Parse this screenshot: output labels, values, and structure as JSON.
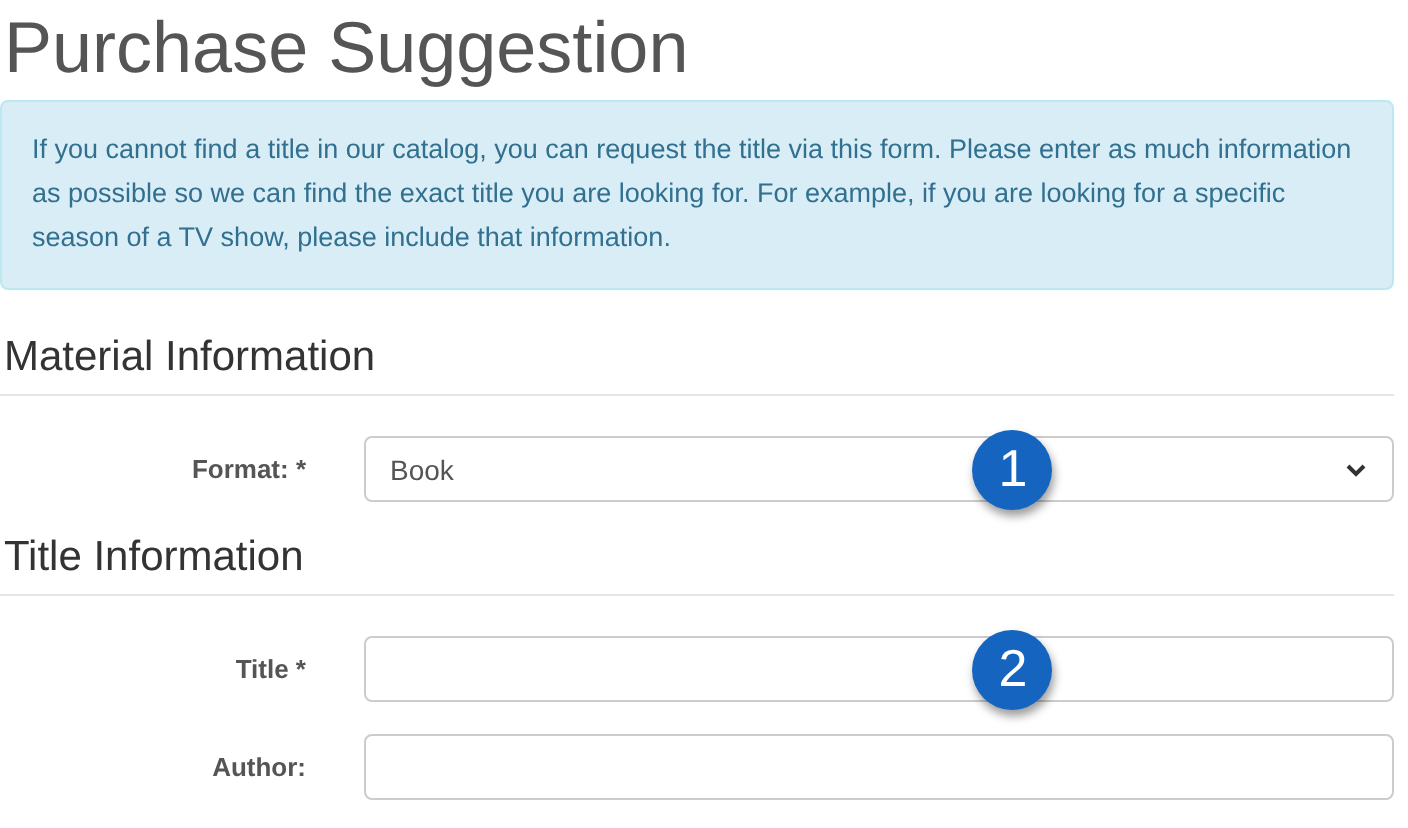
{
  "heading": "Purchase Suggestion",
  "notice": "If you cannot find a title in our catalog, you can request the title via this form. Please enter as much information as possible so we can find the exact title you are looking for. For example, if you are looking for a specific season of a TV show, please include that information.",
  "sections": [
    {
      "title": "Material Information",
      "fields": [
        {
          "label": "Format: *",
          "kind": "select",
          "value": "Book",
          "badge": "1"
        }
      ]
    },
    {
      "title": "Title Information",
      "fields": [
        {
          "label": "Title *",
          "kind": "text",
          "badge": "2"
        },
        {
          "label": "Author:",
          "kind": "text"
        }
      ]
    }
  ]
}
